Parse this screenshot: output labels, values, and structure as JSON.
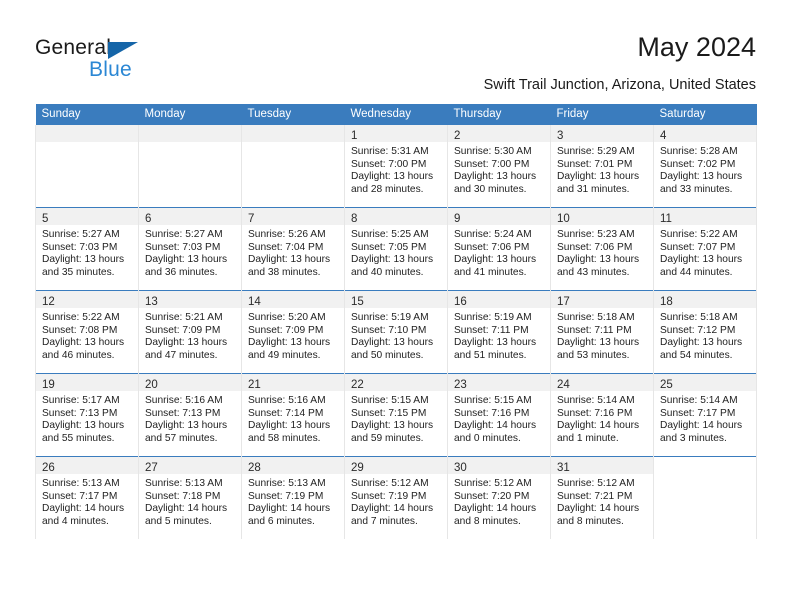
{
  "brand": {
    "name_part1": "General",
    "name_part2": "Blue",
    "accent_color": "#2b87d4",
    "triangle_color": "#1565a8"
  },
  "header": {
    "title": "May 2024",
    "subtitle": "Swift Trail Junction, Arizona, United States"
  },
  "calendar": {
    "header_bg": "#3a7cbe",
    "daynum_bg": "#f1f1f1",
    "weekday_headers": [
      "Sunday",
      "Monday",
      "Tuesday",
      "Wednesday",
      "Thursday",
      "Friday",
      "Saturday"
    ],
    "weeks": [
      [
        {
          "day": "",
          "lines": []
        },
        {
          "day": "",
          "lines": []
        },
        {
          "day": "",
          "lines": []
        },
        {
          "day": "1",
          "lines": [
            "Sunrise: 5:31 AM",
            "Sunset: 7:00 PM",
            "Daylight: 13 hours",
            "and 28 minutes."
          ]
        },
        {
          "day": "2",
          "lines": [
            "Sunrise: 5:30 AM",
            "Sunset: 7:00 PM",
            "Daylight: 13 hours",
            "and 30 minutes."
          ]
        },
        {
          "day": "3",
          "lines": [
            "Sunrise: 5:29 AM",
            "Sunset: 7:01 PM",
            "Daylight: 13 hours",
            "and 31 minutes."
          ]
        },
        {
          "day": "4",
          "lines": [
            "Sunrise: 5:28 AM",
            "Sunset: 7:02 PM",
            "Daylight: 13 hours",
            "and 33 minutes."
          ]
        }
      ],
      [
        {
          "day": "5",
          "lines": [
            "Sunrise: 5:27 AM",
            "Sunset: 7:03 PM",
            "Daylight: 13 hours",
            "and 35 minutes."
          ]
        },
        {
          "day": "6",
          "lines": [
            "Sunrise: 5:27 AM",
            "Sunset: 7:03 PM",
            "Daylight: 13 hours",
            "and 36 minutes."
          ]
        },
        {
          "day": "7",
          "lines": [
            "Sunrise: 5:26 AM",
            "Sunset: 7:04 PM",
            "Daylight: 13 hours",
            "and 38 minutes."
          ]
        },
        {
          "day": "8",
          "lines": [
            "Sunrise: 5:25 AM",
            "Sunset: 7:05 PM",
            "Daylight: 13 hours",
            "and 40 minutes."
          ]
        },
        {
          "day": "9",
          "lines": [
            "Sunrise: 5:24 AM",
            "Sunset: 7:06 PM",
            "Daylight: 13 hours",
            "and 41 minutes."
          ]
        },
        {
          "day": "10",
          "lines": [
            "Sunrise: 5:23 AM",
            "Sunset: 7:06 PM",
            "Daylight: 13 hours",
            "and 43 minutes."
          ]
        },
        {
          "day": "11",
          "lines": [
            "Sunrise: 5:22 AM",
            "Sunset: 7:07 PM",
            "Daylight: 13 hours",
            "and 44 minutes."
          ]
        }
      ],
      [
        {
          "day": "12",
          "lines": [
            "Sunrise: 5:22 AM",
            "Sunset: 7:08 PM",
            "Daylight: 13 hours",
            "and 46 minutes."
          ]
        },
        {
          "day": "13",
          "lines": [
            "Sunrise: 5:21 AM",
            "Sunset: 7:09 PM",
            "Daylight: 13 hours",
            "and 47 minutes."
          ]
        },
        {
          "day": "14",
          "lines": [
            "Sunrise: 5:20 AM",
            "Sunset: 7:09 PM",
            "Daylight: 13 hours",
            "and 49 minutes."
          ]
        },
        {
          "day": "15",
          "lines": [
            "Sunrise: 5:19 AM",
            "Sunset: 7:10 PM",
            "Daylight: 13 hours",
            "and 50 minutes."
          ]
        },
        {
          "day": "16",
          "lines": [
            "Sunrise: 5:19 AM",
            "Sunset: 7:11 PM",
            "Daylight: 13 hours",
            "and 51 minutes."
          ]
        },
        {
          "day": "17",
          "lines": [
            "Sunrise: 5:18 AM",
            "Sunset: 7:11 PM",
            "Daylight: 13 hours",
            "and 53 minutes."
          ]
        },
        {
          "day": "18",
          "lines": [
            "Sunrise: 5:18 AM",
            "Sunset: 7:12 PM",
            "Daylight: 13 hours",
            "and 54 minutes."
          ]
        }
      ],
      [
        {
          "day": "19",
          "lines": [
            "Sunrise: 5:17 AM",
            "Sunset: 7:13 PM",
            "Daylight: 13 hours",
            "and 55 minutes."
          ]
        },
        {
          "day": "20",
          "lines": [
            "Sunrise: 5:16 AM",
            "Sunset: 7:13 PM",
            "Daylight: 13 hours",
            "and 57 minutes."
          ]
        },
        {
          "day": "21",
          "lines": [
            "Sunrise: 5:16 AM",
            "Sunset: 7:14 PM",
            "Daylight: 13 hours",
            "and 58 minutes."
          ]
        },
        {
          "day": "22",
          "lines": [
            "Sunrise: 5:15 AM",
            "Sunset: 7:15 PM",
            "Daylight: 13 hours",
            "and 59 minutes."
          ]
        },
        {
          "day": "23",
          "lines": [
            "Sunrise: 5:15 AM",
            "Sunset: 7:16 PM",
            "Daylight: 14 hours",
            "and 0 minutes."
          ]
        },
        {
          "day": "24",
          "lines": [
            "Sunrise: 5:14 AM",
            "Sunset: 7:16 PM",
            "Daylight: 14 hours",
            "and 1 minute."
          ]
        },
        {
          "day": "25",
          "lines": [
            "Sunrise: 5:14 AM",
            "Sunset: 7:17 PM",
            "Daylight: 14 hours",
            "and 3 minutes."
          ]
        }
      ],
      [
        {
          "day": "26",
          "lines": [
            "Sunrise: 5:13 AM",
            "Sunset: 7:17 PM",
            "Daylight: 14 hours",
            "and 4 minutes."
          ]
        },
        {
          "day": "27",
          "lines": [
            "Sunrise: 5:13 AM",
            "Sunset: 7:18 PM",
            "Daylight: 14 hours",
            "and 5 minutes."
          ]
        },
        {
          "day": "28",
          "lines": [
            "Sunrise: 5:13 AM",
            "Sunset: 7:19 PM",
            "Daylight: 14 hours",
            "and 6 minutes."
          ]
        },
        {
          "day": "29",
          "lines": [
            "Sunrise: 5:12 AM",
            "Sunset: 7:19 PM",
            "Daylight: 14 hours",
            "and 7 minutes."
          ]
        },
        {
          "day": "30",
          "lines": [
            "Sunrise: 5:12 AM",
            "Sunset: 7:20 PM",
            "Daylight: 14 hours",
            "and 8 minutes."
          ]
        },
        {
          "day": "31",
          "lines": [
            "Sunrise: 5:12 AM",
            "Sunset: 7:21 PM",
            "Daylight: 14 hours",
            "and 8 minutes."
          ]
        },
        {
          "day": "",
          "lines": []
        }
      ]
    ]
  }
}
